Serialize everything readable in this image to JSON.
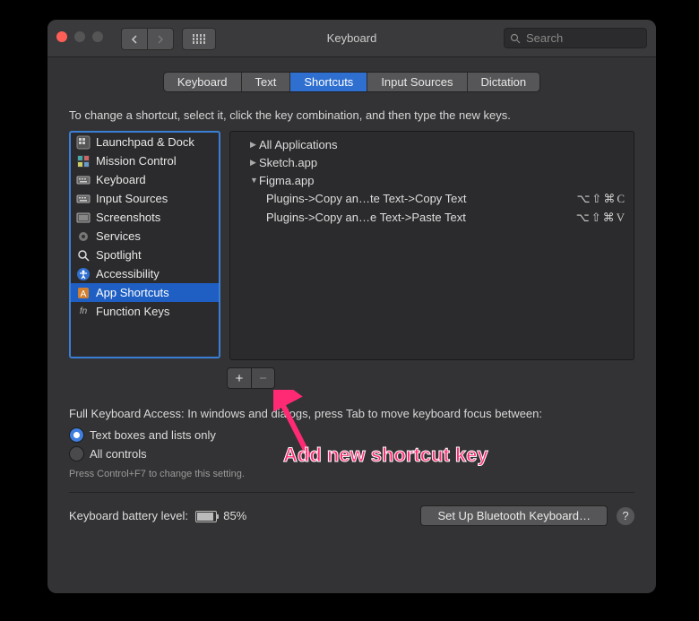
{
  "titlebar": {
    "title": "Keyboard",
    "search_placeholder": "Search"
  },
  "tabs": [
    "Keyboard",
    "Text",
    "Shortcuts",
    "Input Sources",
    "Dictation"
  ],
  "active_tab": 2,
  "instruction": "To change a shortcut, select it, click the key combination, and then type the new keys.",
  "categories": [
    {
      "icon": "grid",
      "label": "Launchpad & Dock"
    },
    {
      "icon": "mc",
      "label": "Mission Control"
    },
    {
      "icon": "kb",
      "label": "Keyboard"
    },
    {
      "icon": "kb",
      "label": "Input Sources"
    },
    {
      "icon": "ss",
      "label": "Screenshots"
    },
    {
      "icon": "gear",
      "label": "Services"
    },
    {
      "icon": "spot",
      "label": "Spotlight"
    },
    {
      "icon": "acc",
      "label": "Accessibility"
    },
    {
      "icon": "app",
      "label": "App Shortcuts"
    },
    {
      "icon": "fn",
      "label": "Function Keys"
    }
  ],
  "selected_category": 8,
  "shortcut_tree": [
    {
      "type": "group",
      "expanded": false,
      "label": "All Applications"
    },
    {
      "type": "group",
      "expanded": false,
      "label": "Sketch.app"
    },
    {
      "type": "group",
      "expanded": true,
      "label": "Figma.app"
    },
    {
      "type": "item",
      "label": "Plugins->Copy an…te Text->Copy Text",
      "keys": "⌥⇧⌘C"
    },
    {
      "type": "item",
      "label": "Plugins->Copy an…e Text->Paste Text",
      "keys": "⌥⇧⌘V"
    }
  ],
  "buttons": {
    "add": "+",
    "remove": "−"
  },
  "fka": {
    "intro": "Full Keyboard Access: In windows and dialogs, press Tab to move keyboard focus between:",
    "opt1": "Text boxes and lists only",
    "opt2": "All controls",
    "selected": 0,
    "hint": "Press Control+F7 to change this setting."
  },
  "footer": {
    "battery_label": "Keyboard battery level:",
    "battery_pct": "85%",
    "bt_button": "Set Up Bluetooth Keyboard…",
    "help": "?"
  },
  "annotation": "Add new shortcut key"
}
